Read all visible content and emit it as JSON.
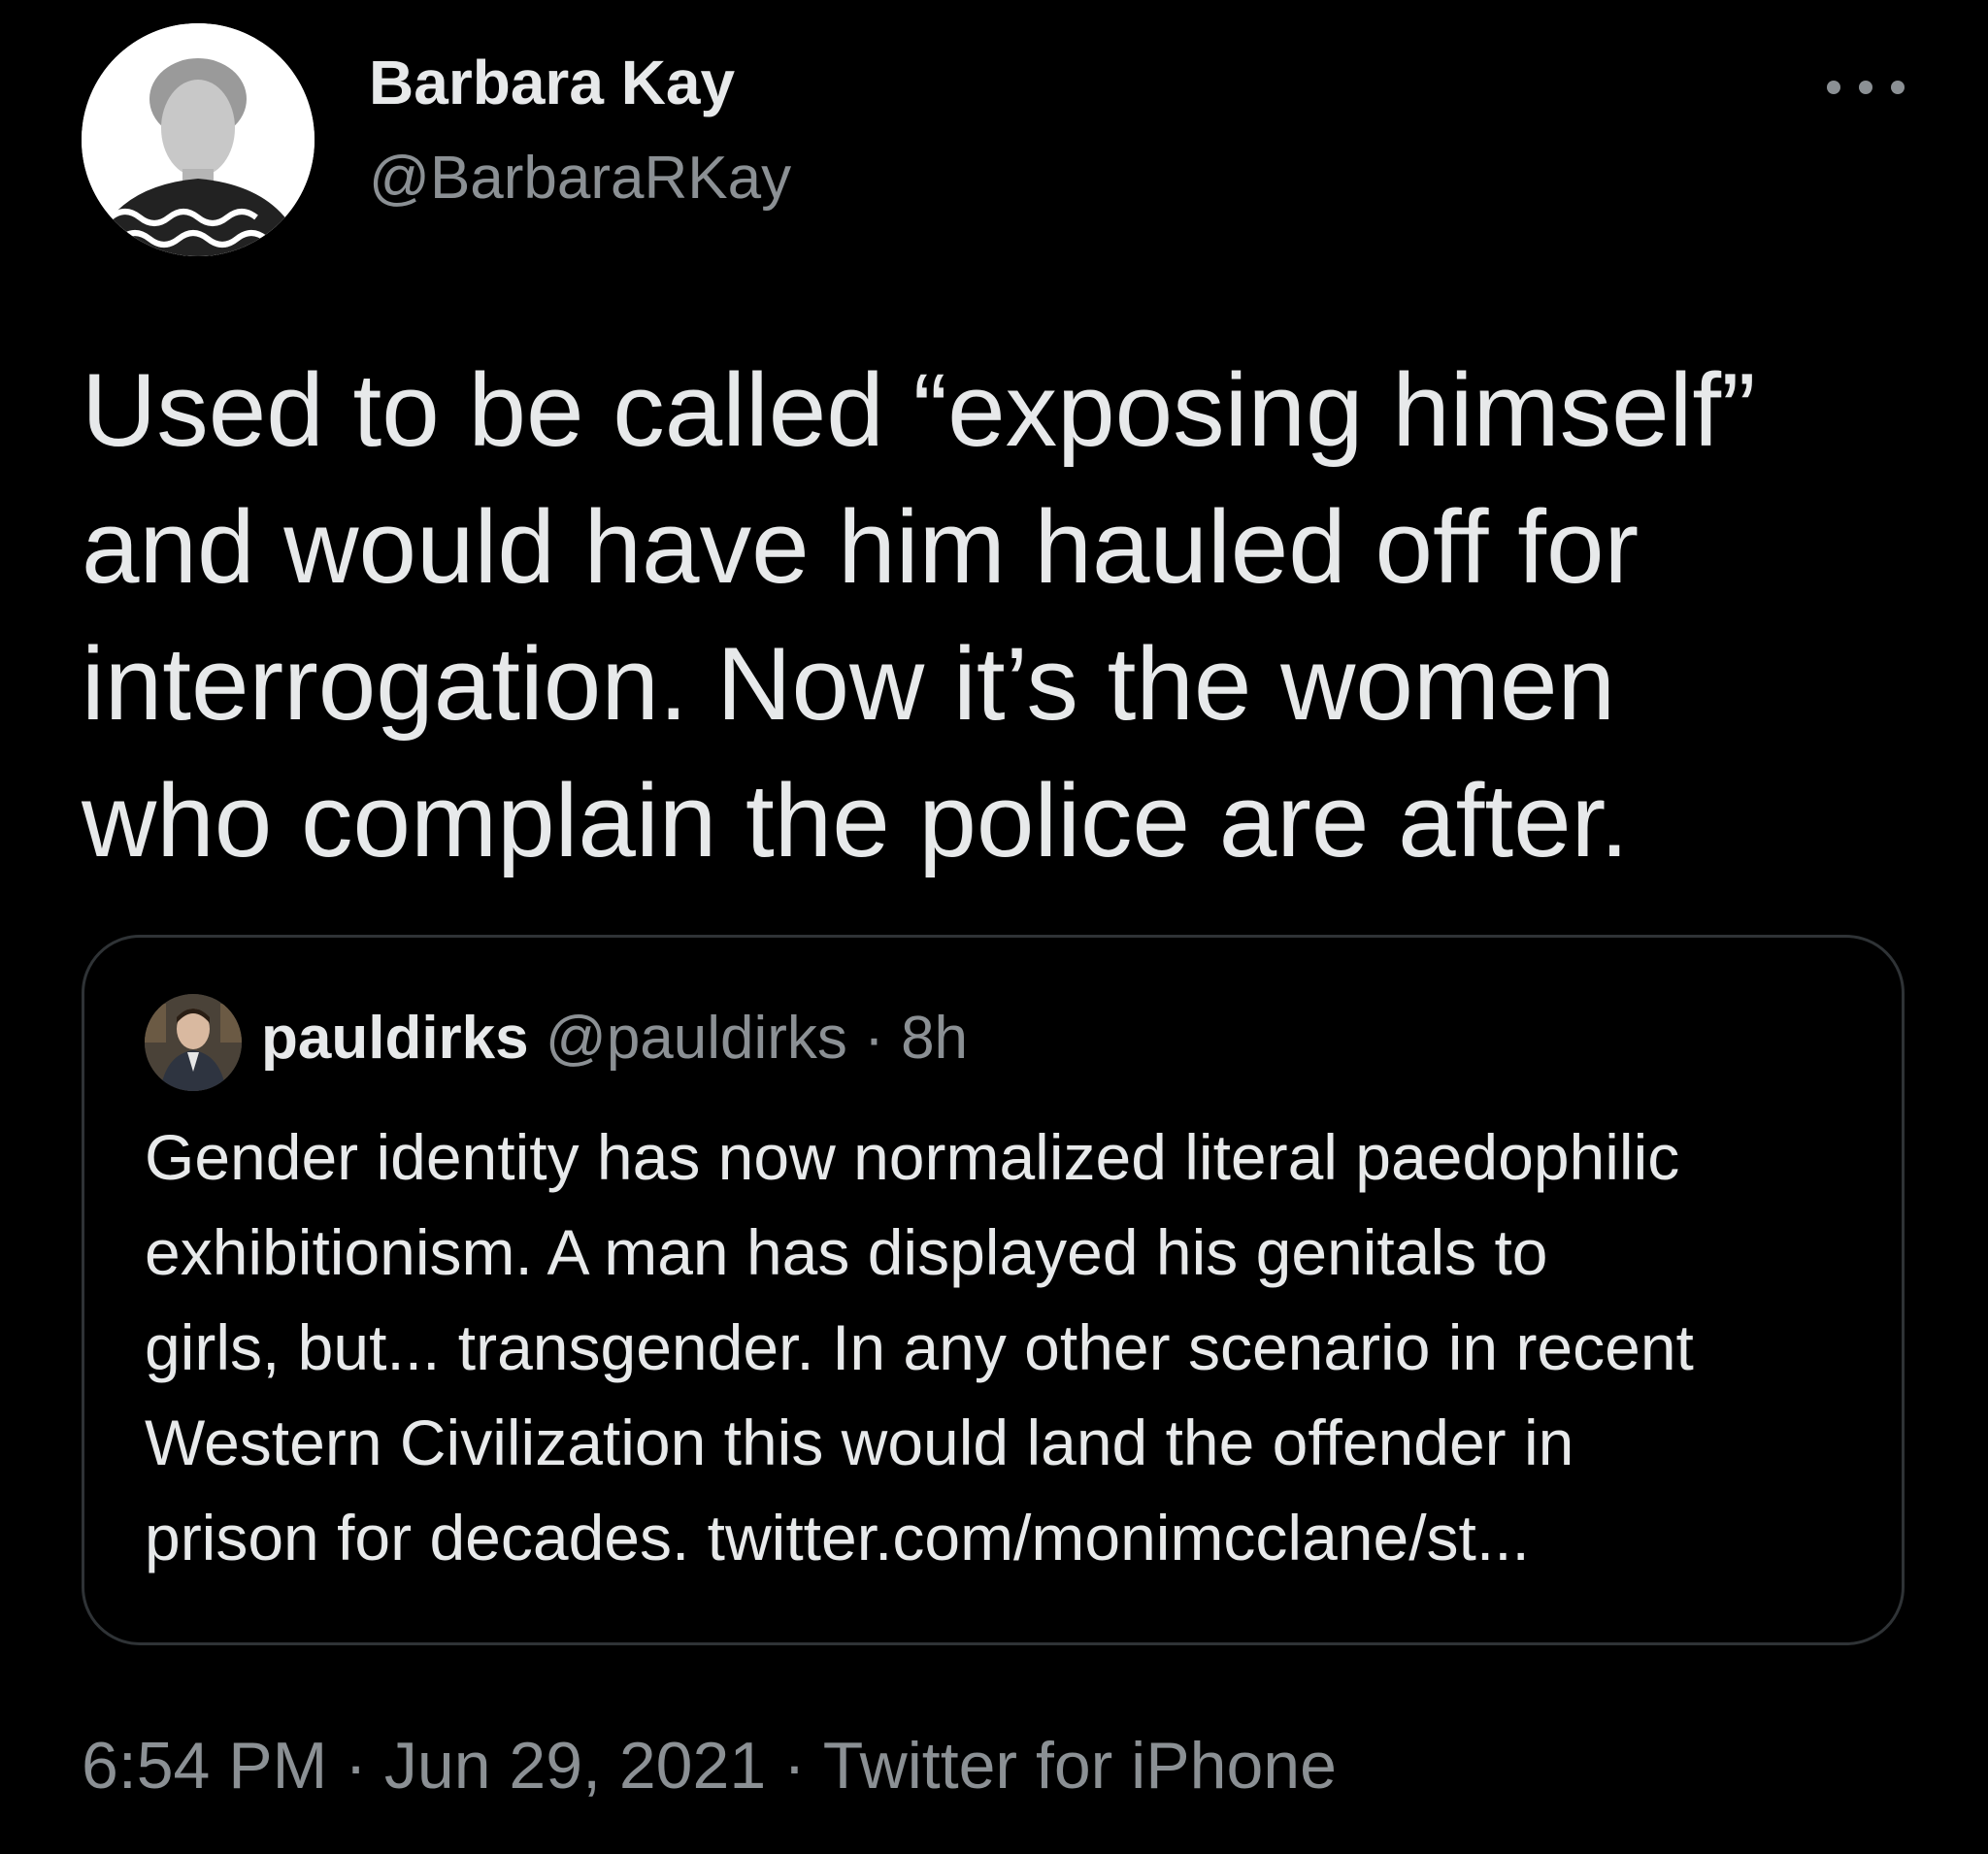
{
  "author": {
    "display_name": "Barbara Kay",
    "handle": "@BarbaraRKay"
  },
  "tweet": {
    "text_lines": [
      "Used to be called “exposing himself”",
      "and would have him hauled off for",
      "interrogation. Now it’s the women",
      "who complain the police are after."
    ]
  },
  "quoted_tweet": {
    "display_name": "pauldirks",
    "handle": "@pauldirks",
    "separator": "·",
    "time": "8h",
    "text_lines": [
      "Gender identity has now normalized literal paedophilic",
      "exhibitionism. A man has displayed his genitals to",
      "girls, but... transgender. In any other scenario in recent",
      "Western Civilization this would land the offender in",
      "prison for decades. twitter.com/monimcclane/st..."
    ]
  },
  "meta": {
    "time": "6:54 PM",
    "separator": "·",
    "date": "Jun 29, 2021",
    "source": "Twitter for iPhone"
  },
  "icons": {
    "more": "more-horizontal-icon"
  },
  "colors": {
    "background": "#000000",
    "primary_text": "#e7e9ea",
    "secondary_text": "#8b9094",
    "border": "#2f3336"
  }
}
